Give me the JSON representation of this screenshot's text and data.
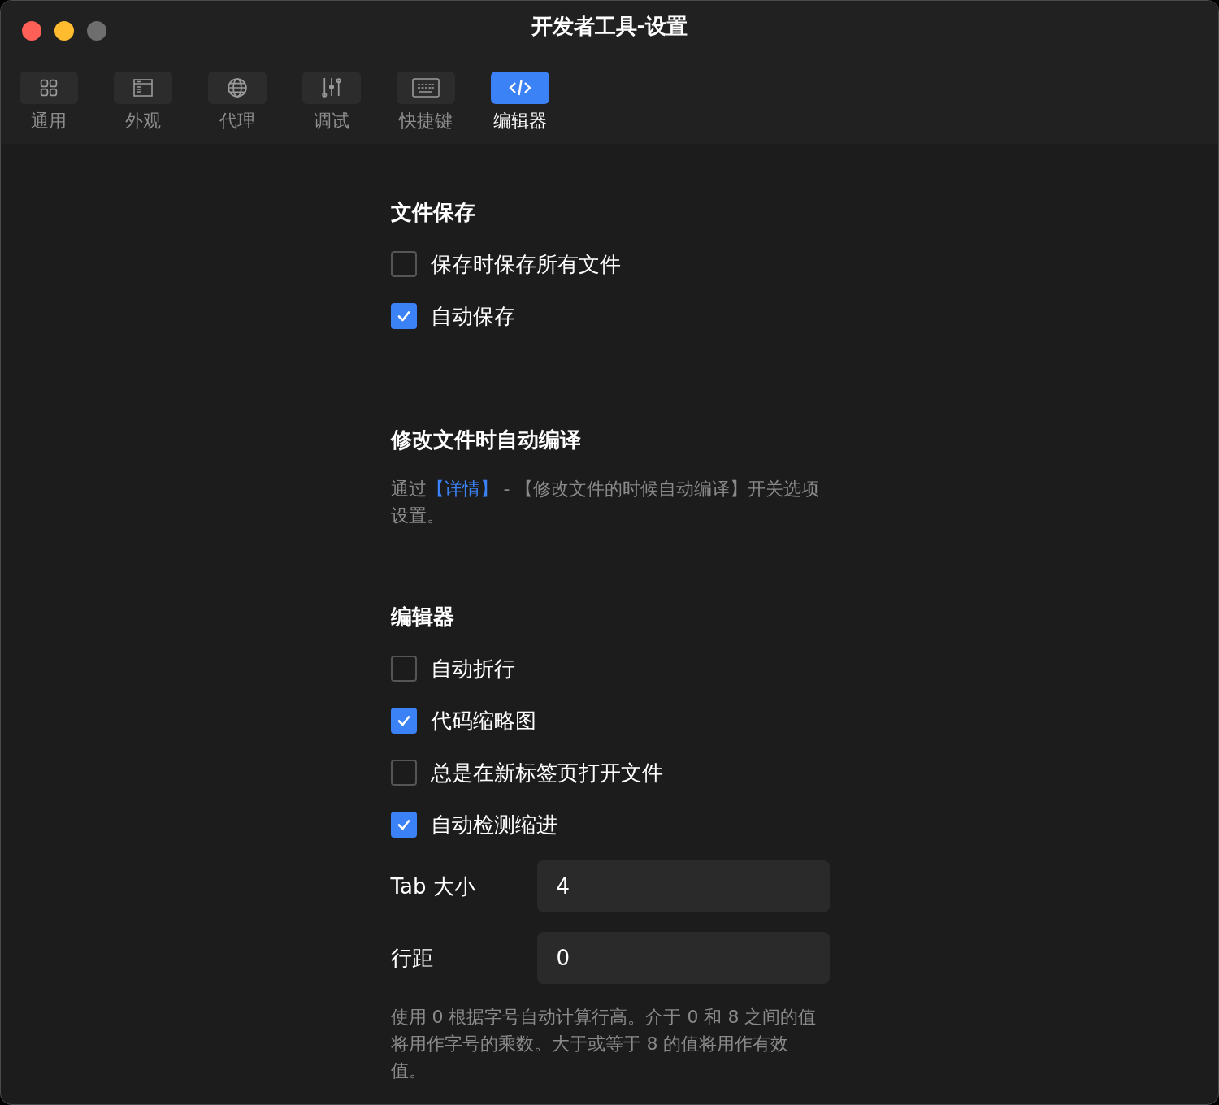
{
  "window": {
    "title": "开发者工具-设置"
  },
  "tabs": [
    {
      "label": "通用",
      "selected": false
    },
    {
      "label": "外观",
      "selected": false
    },
    {
      "label": "代理",
      "selected": false
    },
    {
      "label": "调试",
      "selected": false
    },
    {
      "label": "快捷键",
      "selected": false
    },
    {
      "label": "编辑器",
      "selected": true
    }
  ],
  "sections": [
    {
      "title": "文件保存",
      "items": [
        {
          "kind": "checkbox",
          "label": "保存时保存所有文件",
          "checked": false
        },
        {
          "kind": "checkbox",
          "label": "自动保存",
          "checked": true
        }
      ]
    },
    {
      "title": "修改文件时自动编译",
      "items": [
        {
          "kind": "note",
          "before": "通过",
          "link": "【详情】",
          "after": " - 【修改文件的时候自动编译】开关选项设置。"
        }
      ]
    },
    {
      "title": "编辑器",
      "items": [
        {
          "kind": "checkbox",
          "label": "自动折行",
          "checked": false
        },
        {
          "kind": "checkbox",
          "label": "代码缩略图",
          "checked": true
        },
        {
          "kind": "checkbox",
          "label": "总是在新标签页打开文件",
          "checked": false
        },
        {
          "kind": "checkbox",
          "label": "自动检测缩进",
          "checked": true
        },
        {
          "kind": "field",
          "label": "Tab 大小",
          "value": "4"
        },
        {
          "kind": "field",
          "label": "行距",
          "value": "0"
        },
        {
          "kind": "help",
          "text": "使用 0 根据字号自动计算行高。介于 0 和 8 之间的值将用作字号的乘数。大于或等于 8 的值将用作有效值。"
        }
      ]
    }
  ]
}
